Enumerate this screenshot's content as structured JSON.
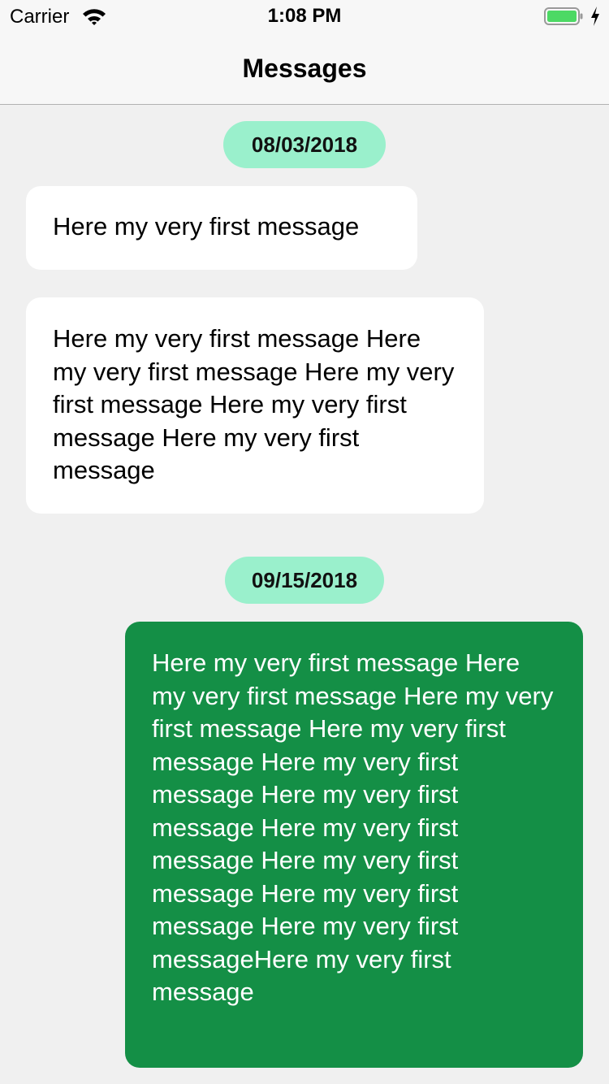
{
  "status_bar": {
    "carrier": "Carrier",
    "time": "1:08 PM",
    "battery_color": "#4cd964"
  },
  "nav": {
    "title": "Messages"
  },
  "colors": {
    "background": "#f0f0f0",
    "date_pill": "#9af0cc",
    "incoming_bubble": "#ffffff",
    "outgoing_bubble": "#148f46"
  },
  "messages": {
    "date_1": "08/03/2018",
    "msg_1": "Here my very first message",
    "msg_2": "Here my very first message Here my very first message Here my very first message Here my very first message Here my very first message",
    "date_2": "09/15/2018",
    "msg_3": "Here my very first message Here my very first message Here my very first message Here my very first message Here my very first message Here my very first message Here my very first message Here my very first message Here my very first message Here my very first messageHere my very first message"
  }
}
